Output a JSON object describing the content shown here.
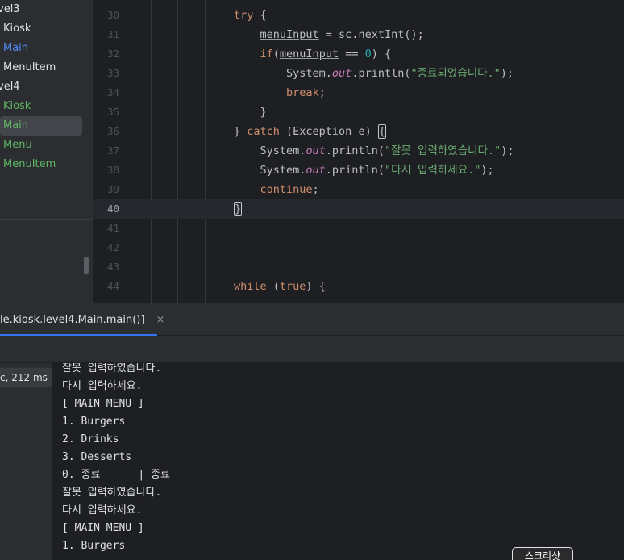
{
  "project_tree": {
    "items": [
      {
        "label": "vel3",
        "color": "#dfe1e5"
      },
      {
        "label": "Kiosk",
        "color": "#dfe1e5"
      },
      {
        "label": "Main",
        "color": "#548af7"
      },
      {
        "label": "MenuItem",
        "color": "#dfe1e5"
      },
      {
        "label": "vel4",
        "color": "#dfe1e5"
      },
      {
        "label": "Kiosk",
        "color": "#5fb865"
      },
      {
        "label": "Main",
        "color": "#5fb865"
      },
      {
        "label": "Menu",
        "color": "#5fb865"
      },
      {
        "label": "MenuItem",
        "color": "#5fb865"
      }
    ]
  },
  "editor": {
    "current_line": "40",
    "lines": [
      {
        "num": "30",
        "code": "<span class=\"k\">try</span> {"
      },
      {
        "num": "31",
        "code": "    <span class=\"u\">menuInput</span> = sc.nextInt();"
      },
      {
        "num": "32",
        "code": "    <span class=\"k\">if</span>(<span class=\"u\">menuInput</span> == <span class=\"n\">0</span>) {"
      },
      {
        "num": "33",
        "code": "        System.<span class=\"f\">out</span>.println(<span class=\"s\">\"종료되었습니다.\"</span>);"
      },
      {
        "num": "34",
        "code": "        <span class=\"k\">break</span>;"
      },
      {
        "num": "35",
        "code": "    }"
      },
      {
        "num": "36",
        "code": "} <span class=\"k\">catch</span> (Exception e) <span class=\"bh\">{</span>"
      },
      {
        "num": "37",
        "code": "    System.<span class=\"f\">out</span>.println(<span class=\"s\">\"잘못 입력하였습니다.\"</span>);"
      },
      {
        "num": "38",
        "code": "    System.<span class=\"f\">out</span>.println(<span class=\"s\">\"다시 입력하세요.\"</span>);"
      },
      {
        "num": "39",
        "code": "    <span class=\"k\">continue</span>;"
      },
      {
        "num": "40",
        "code": "<span class=\"bh\">}</span>"
      },
      {
        "num": "41",
        "code": ""
      },
      {
        "num": "42",
        "code": ""
      },
      {
        "num": "43",
        "code": ""
      },
      {
        "num": "44",
        "code": "<span class=\"k\">while</span> (<span class=\"k\">true</span>) {"
      }
    ]
  },
  "run_panel": {
    "tab_label": "le.kiosk.level4.Main.main()]",
    "tab_close": "×",
    "tree_node": "c, 212 ms",
    "console_lines": [
      "잘못 입력하였습니다.",
      "다시 입력하세요.",
      "[ MAIN MENU ]",
      "1. Burgers",
      "2. Drinks",
      "3. Desserts",
      "0. 종료      | 종료",
      "잘못 입력하였습니다.",
      "다시 입력하세요.",
      "[ MAIN MENU ]",
      "1. Burgers"
    ]
  },
  "tooltip": {
    "label": "스크리샷"
  }
}
